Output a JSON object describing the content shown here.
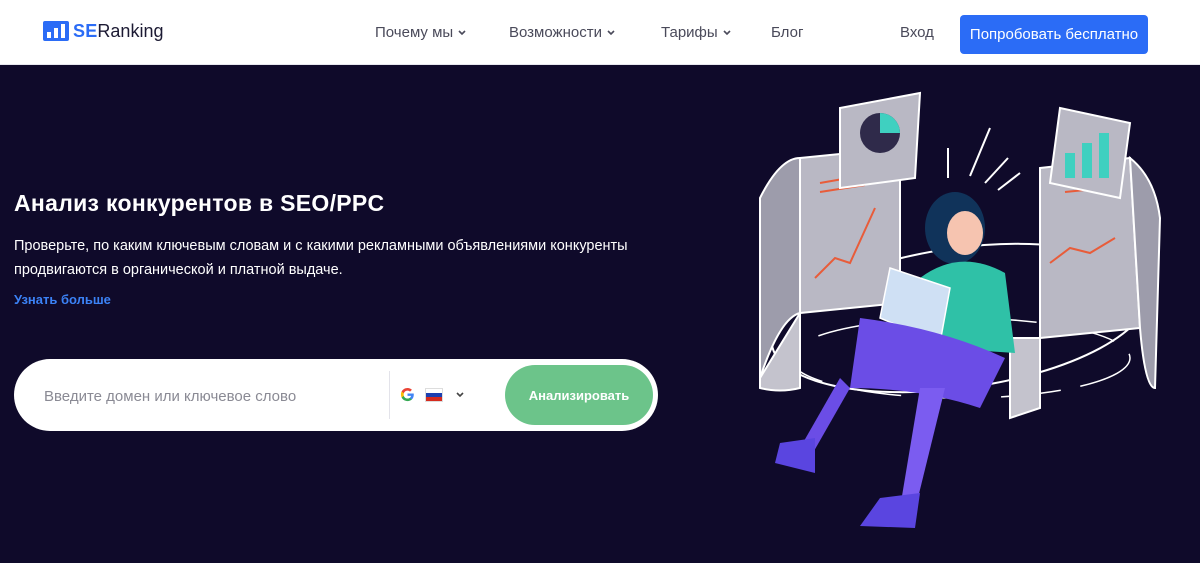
{
  "header": {
    "logo": {
      "brand_strong": "SE",
      "brand_rest": "Ranking"
    },
    "nav": [
      {
        "label": "Почему мы",
        "has_dropdown": true
      },
      {
        "label": "Возможности",
        "has_dropdown": true
      },
      {
        "label": "Тарифы",
        "has_dropdown": true
      },
      {
        "label": "Блог",
        "has_dropdown": false
      }
    ],
    "login": "Вход",
    "cta": "Попробовать бесплатно"
  },
  "hero": {
    "title": "Анализ конкурентов в SEO/PPC",
    "description": "Проверьте, по каким ключевым словам и с какими рекламными объявлениями конкуренты продвигаются в органической и платной выдаче.",
    "learn_more": "Узнать больше"
  },
  "search": {
    "placeholder": "Введите домен или ключевое слово",
    "value": "",
    "engine_icon": "google-icon",
    "country_icon": "russia-flag-icon",
    "analyze_label": "Анализировать"
  },
  "colors": {
    "brand_blue": "#2b6cf6",
    "hero_bg": "#0f0a2a",
    "analyze_green": "#6cc48a",
    "link_blue": "#3b82f6"
  }
}
